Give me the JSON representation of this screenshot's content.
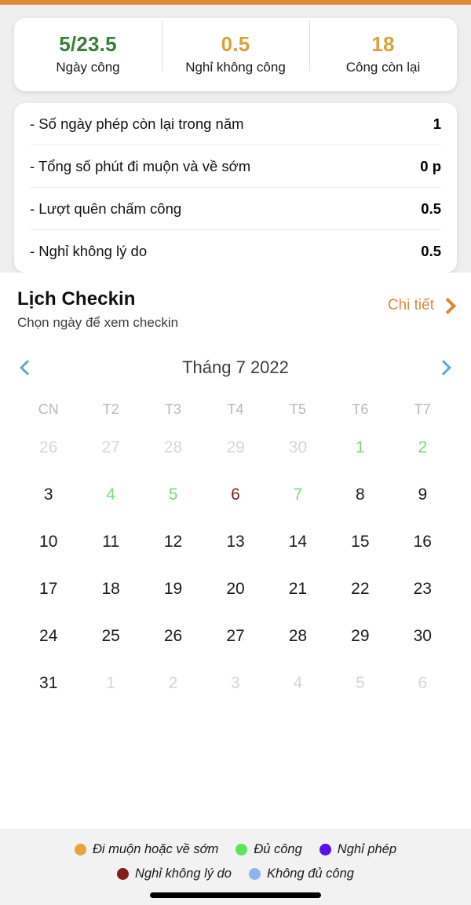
{
  "theme": {
    "accent_orange": "#e08b3c",
    "green": "#3a7d3a",
    "gold": "#d9a23a",
    "link_orange": "#d8893d",
    "nav_blue": "#62a8d6"
  },
  "summary": {
    "stats": [
      {
        "value": "5/23.5",
        "label": "Ngày công",
        "color": "#3a7d3a"
      },
      {
        "value": "0.5",
        "label": "Nghỉ không công",
        "color": "#d9a23a"
      },
      {
        "value": "18",
        "label": "Công còn lại",
        "color": "#d9a23a"
      }
    ]
  },
  "details": {
    "rows": [
      {
        "label": "- Số ngày phép còn lại trong năm",
        "value": "1"
      },
      {
        "label": "- Tổng số phút đi muộn và về sớm",
        "value": "0 p"
      },
      {
        "label": "- Lượt quên chấm công",
        "value": "0.5"
      },
      {
        "label": "- Nghỉ không lý do",
        "value": "0.5"
      }
    ]
  },
  "checkin": {
    "title": "Lịch Checkin",
    "subtitle": "Chọn ngày để xem checkin",
    "detail_link": "Chi tiết",
    "detail_icon": "chevron-right-icon"
  },
  "calendar": {
    "month_label": "Tháng 7 2022",
    "prev_icon": "chevron-left-icon",
    "next_icon": "chevron-right-icon",
    "weekdays": [
      "CN",
      "T2",
      "T3",
      "T4",
      "T5",
      "T6",
      "T7"
    ],
    "weeks": [
      [
        {
          "d": "26",
          "state": "muted"
        },
        {
          "d": "27",
          "state": "muted"
        },
        {
          "d": "28",
          "state": "muted"
        },
        {
          "d": "29",
          "state": "muted"
        },
        {
          "d": "30",
          "state": "muted"
        },
        {
          "d": "1",
          "state": "green"
        },
        {
          "d": "2",
          "state": "green"
        }
      ],
      [
        {
          "d": "3",
          "state": "normal"
        },
        {
          "d": "4",
          "state": "green"
        },
        {
          "d": "5",
          "state": "green"
        },
        {
          "d": "6",
          "state": "red"
        },
        {
          "d": "7",
          "state": "green"
        },
        {
          "d": "8",
          "state": "normal"
        },
        {
          "d": "9",
          "state": "normal"
        }
      ],
      [
        {
          "d": "10",
          "state": "normal"
        },
        {
          "d": "11",
          "state": "normal"
        },
        {
          "d": "12",
          "state": "normal"
        },
        {
          "d": "13",
          "state": "normal"
        },
        {
          "d": "14",
          "state": "normal"
        },
        {
          "d": "15",
          "state": "normal"
        },
        {
          "d": "16",
          "state": "normal"
        }
      ],
      [
        {
          "d": "17",
          "state": "normal"
        },
        {
          "d": "18",
          "state": "normal"
        },
        {
          "d": "19",
          "state": "normal"
        },
        {
          "d": "20",
          "state": "normal"
        },
        {
          "d": "21",
          "state": "normal"
        },
        {
          "d": "22",
          "state": "normal"
        },
        {
          "d": "23",
          "state": "normal"
        }
      ],
      [
        {
          "d": "24",
          "state": "normal"
        },
        {
          "d": "25",
          "state": "normal"
        },
        {
          "d": "26",
          "state": "normal"
        },
        {
          "d": "27",
          "state": "normal"
        },
        {
          "d": "28",
          "state": "normal"
        },
        {
          "d": "29",
          "state": "normal"
        },
        {
          "d": "30",
          "state": "normal"
        }
      ],
      [
        {
          "d": "31",
          "state": "normal"
        },
        {
          "d": "1",
          "state": "muted"
        },
        {
          "d": "2",
          "state": "muted"
        },
        {
          "d": "3",
          "state": "muted"
        },
        {
          "d": "4",
          "state": "muted"
        },
        {
          "d": "5",
          "state": "muted"
        },
        {
          "d": "6",
          "state": "muted"
        }
      ]
    ]
  },
  "legend": {
    "rows": [
      [
        {
          "label": "Đi muộn hoặc về sớm",
          "color": "#e8a33d"
        },
        {
          "label": "Đủ công",
          "color": "#5de35d"
        },
        {
          "label": "Nghỉ phép",
          "color": "#5b10e8"
        }
      ],
      [
        {
          "label": "Nghỉ không lý do",
          "color": "#8b1a1a"
        },
        {
          "label": "Không đủ công",
          "color": "#8fb4ec"
        }
      ]
    ]
  }
}
